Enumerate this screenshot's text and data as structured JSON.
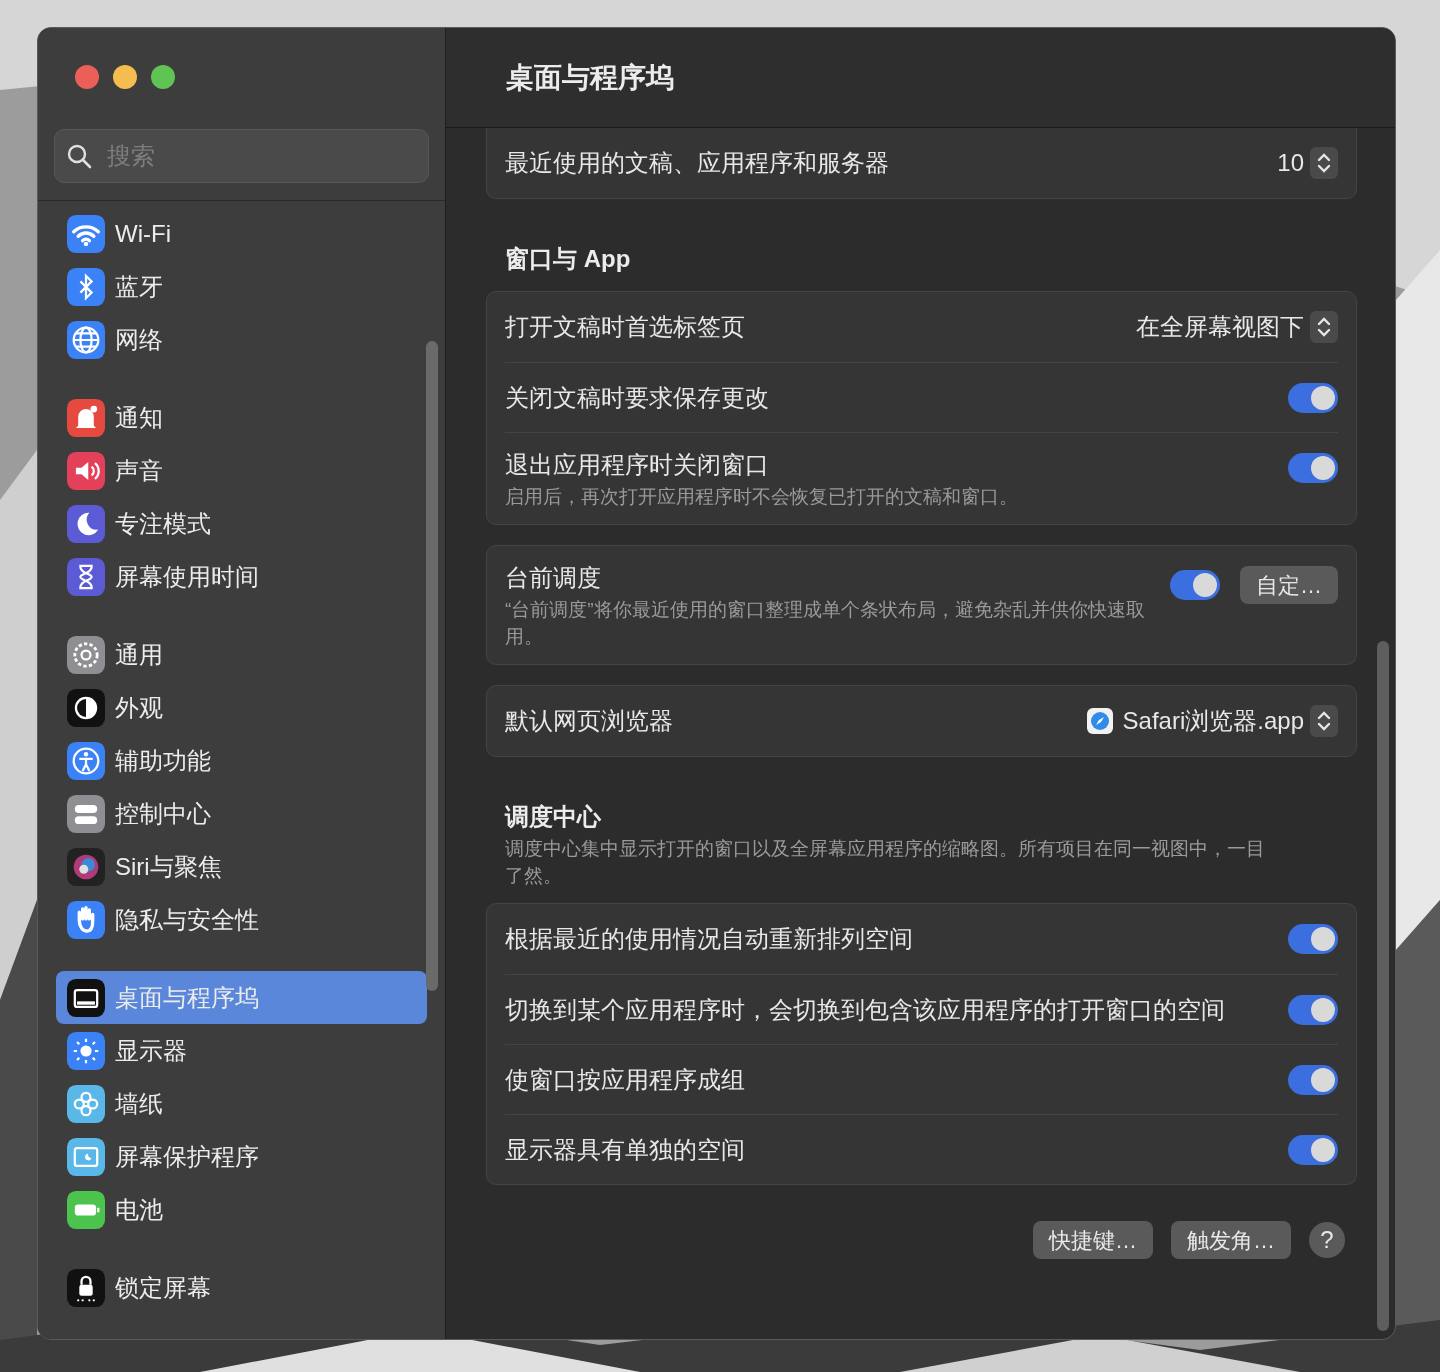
{
  "window": {
    "title": "桌面与程序坞"
  },
  "sidebar": {
    "search": {
      "placeholder": "搜索"
    },
    "groups": [
      [
        {
          "label": "Wi-Fi",
          "selected": false
        },
        {
          "label": "蓝牙",
          "selected": false
        },
        {
          "label": "网络",
          "selected": false
        }
      ],
      [
        {
          "label": "通知",
          "selected": false
        },
        {
          "label": "声音",
          "selected": false
        },
        {
          "label": "专注模式",
          "selected": false
        },
        {
          "label": "屏幕使用时间",
          "selected": false
        }
      ],
      [
        {
          "label": "通用",
          "selected": false
        },
        {
          "label": "外观",
          "selected": false
        },
        {
          "label": "辅助功能",
          "selected": false
        },
        {
          "label": "控制中心",
          "selected": false
        },
        {
          "label": "Siri与聚焦",
          "selected": false
        },
        {
          "label": "隐私与安全性",
          "selected": false
        }
      ],
      [
        {
          "label": "桌面与程序坞",
          "selected": true
        },
        {
          "label": "显示器",
          "selected": false
        },
        {
          "label": "墙纸",
          "selected": false
        },
        {
          "label": "屏幕保护程序",
          "selected": false
        },
        {
          "label": "电池",
          "selected": false
        }
      ],
      [
        {
          "label": "锁定屏幕",
          "selected": false
        }
      ]
    ]
  },
  "sections": [
    {
      "rows": [
        {
          "kind": "stepper",
          "label": "最近使用的文稿、应用程序和服务器",
          "value": "10"
        }
      ]
    },
    {
      "heading": "窗口与 App",
      "rows": [
        {
          "kind": "popup",
          "label": "打开文稿时首选标签页",
          "value": "在全屏幕视图下"
        },
        {
          "kind": "toggle",
          "label": "关闭文稿时要求保存更改",
          "on": true
        },
        {
          "kind": "toggle",
          "label": "退出应用程序时关闭窗口",
          "description": "启用后，再次打开应用程序时不会恢复已打开的文稿和窗口。",
          "on": true
        }
      ]
    },
    {
      "rows": [
        {
          "kind": "toggle",
          "label": "台前调度",
          "description": "“台前调度”将你最近使用的窗口整理成单个条状布局，避免杂乱并供你快速取用。",
          "on": true,
          "button": "自定…"
        }
      ]
    },
    {
      "rows": [
        {
          "kind": "app_popup",
          "label": "默认网页浏览器",
          "value": "Safari浏览器.app"
        }
      ]
    },
    {
      "heading": "调度中心",
      "description": "调度中心集中显示打开的窗口以及全屏幕应用程序的缩略图。所有项目在同一视图中，一目了然。",
      "rows": [
        {
          "kind": "toggle",
          "label": "根据最近的使用情况自动重新排列空间",
          "on": true
        },
        {
          "kind": "toggle",
          "label": "切换到某个应用程序时，会切换到包含该应用程序的打开窗口的空间",
          "on": true
        },
        {
          "kind": "toggle",
          "label": "使窗口按应用程序成组",
          "on": true
        },
        {
          "kind": "toggle",
          "label": "显示器具有单独的空间",
          "on": true
        }
      ]
    }
  ],
  "footer_buttons": [
    "快捷键…",
    "触发角…",
    "?"
  ]
}
